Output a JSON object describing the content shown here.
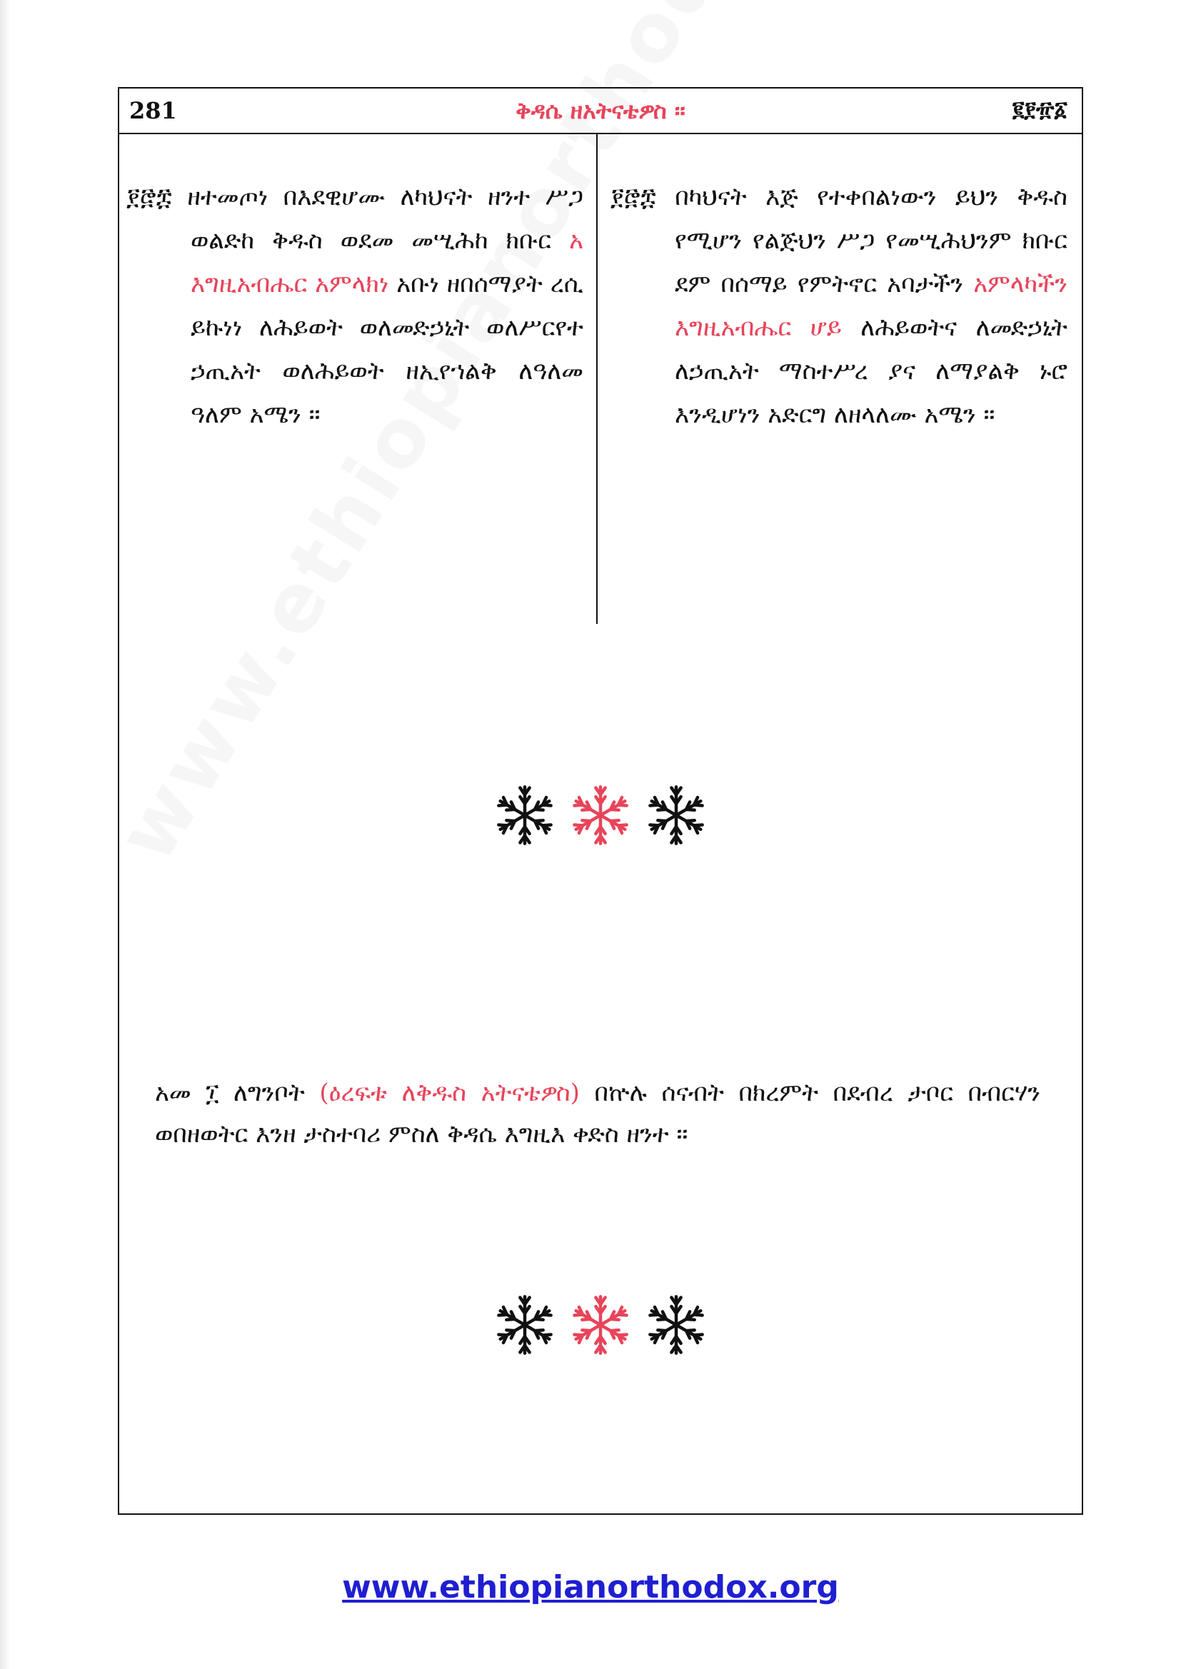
{
  "header": {
    "page_number": "281",
    "title": "ቅዳሴ ዘአትናቴዎስ ።",
    "page_number_geez": "፪፻፹፩"
  },
  "left_column": {
    "number": "፻፸፰",
    "part1": "ዘተመጦነ በእደዊሆሙ ለካህናት ዘንተ ሥጋ ወልድከ ቅዱስ ወደመ መሢሕከ ክቡር",
    "highlight": "አ እግዚአብሔር አምላክነ",
    "part2": "አቡነ ዘበሰማያት ረሲ ይኩነነ ለሕይወት ወለመድኃኒት ወለሥርየተ ኃጢአት ወለሕይወት ዘኢየኀልቅ ለዓለመ ዓለም አሜን ።"
  },
  "right_column": {
    "number": "፻፸፰",
    "part1": "በካህናት እጅ የተቀበልነውን ይህን ቅዱስ የሚሆን የልጅህን ሥጋ የመሢሕህንም ክቡር ደም በሰማይ የምትኖር አባታችን",
    "highlight": "አምላካችን እግዚአብሔር ሆይ",
    "part2": "ለሕይወትና ለመድኃኒት ለኃጢአት ማስተሥረ ያና ለማያልቅ ኑሮ እንዲሆነን አድርግ ለዘላለሙ አሜን ።"
  },
  "note": {
    "part1": "አመ ፲ ለግንቦት",
    "highlight": "(ዕረፍቱ ለቅዱስ አትናቴዎስ)",
    "part2": "በኵሉ ሰናብት በክረምት በደብረ ታቦር በብርሃን ወበዘወትር እንዘ ታስተባሪ ምስለ ቅዳሴ እግዚእ ቀድስ ዘንተ ።"
  },
  "ornament": {
    "icon": "snowflake-icon",
    "colors": [
      "#111111",
      "#e8445a",
      "#111111"
    ]
  },
  "footer": {
    "url": "www.ethiopianorthodox.org"
  },
  "watermark": {
    "text": "www.ethiopianorthodox.org"
  }
}
